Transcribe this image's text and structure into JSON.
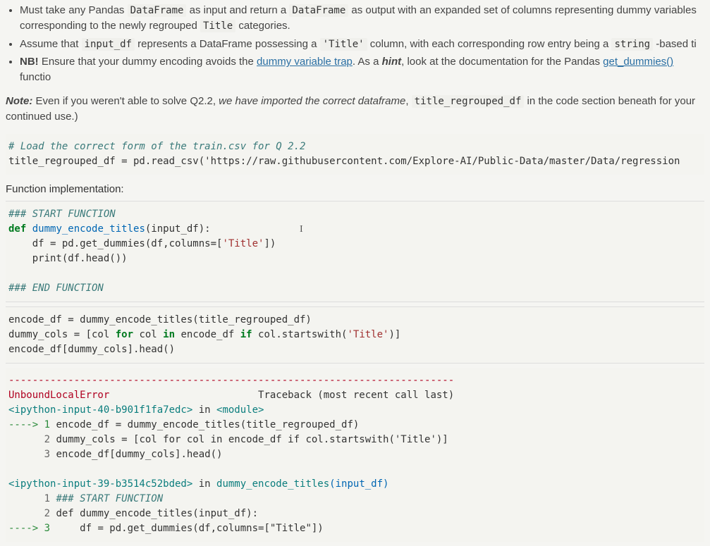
{
  "bullets": {
    "b1_pre": "Must take any Pandas ",
    "b1_code1": "DataFrame",
    "b1_mid1": " as input and return a ",
    "b1_code2": "DataFrame",
    "b1_mid2": " as output with an expanded set of columns representing dummy variables corresponding to the newly regrouped ",
    "b1_code3": "Title",
    "b1_post": " categories.",
    "b2_pre": "Assume that ",
    "b2_code1": "input_df",
    "b2_mid1": " represents a DataFrame possessing a ",
    "b2_code2": "'Title'",
    "b2_mid2": " column, with each corresponding row entry being a ",
    "b2_code3": "string",
    "b2_post": " -based ti",
    "b3_pre": "NB!",
    "b3_mid1": " Ensure that your dummy encoding avoids the ",
    "b3_link1": "dummy variable trap",
    "b3_mid2": ". As a ",
    "b3_hint": "hint",
    "b3_mid3": ", look at the documentation for the Pandas ",
    "b3_link2": "get_dummies()",
    "b3_post": " functio"
  },
  "note": {
    "label": "Note:",
    "t1": " Even if you weren't able to solve Q2.2, ",
    "t2": "we have imported the correct dataframe",
    "t3": ", ",
    "code": "title_regrouped_df",
    "t4": " in the code section beneath for your continued use.)"
  },
  "code1": {
    "comment": "# Load the correct form of the train.csv for Q 2.2",
    "line": "title_regrouped_df = pd.read_csv('https://raw.githubusercontent.com/Explore-AI/Public-Data/master/Data/regression"
  },
  "subhead": "Function implementation:",
  "code2": {
    "l1": "### START FUNCTION",
    "l2_def": "def",
    "l2_name": " dummy_encode_titles",
    "l2_rest": "(input_df):",
    "l3_a": "    df = pd.get_dummies(df,columns=[",
    "l3_str": "'Title'",
    "l3_b": "])",
    "l4_a": "    print(df.head())",
    "l6": "### END FUNCTION"
  },
  "code3": {
    "l1": "encode_df = dummy_encode_titles(title_regrouped_df)",
    "l2_a": "dummy_cols = [col ",
    "l2_for": "for",
    "l2_b": " col ",
    "l2_in": "in",
    "l2_c": " encode_df ",
    "l2_if": "if",
    "l2_d": " col.startswith(",
    "l2_str": "'Title'",
    "l2_e": ")]",
    "l3": "encode_df[dummy_cols].head()"
  },
  "trace": {
    "sep": "---------------------------------------------------------------------------",
    "err": "UnboundLocalError",
    "tb": "Traceback (most recent call last)",
    "mod1_a": "<ipython-input-40-b901f1fa7edc>",
    "mod1_b": " in ",
    "mod1_c": "<module>",
    "arrow": "----> 1",
    "l1": " encode_df = dummy_encode_titles(title_regrouped_df)",
    "n2": "      2",
    "l2": " dummy_cols = [col for col in encode_df if col.startswith('Title')]",
    "n3": "      3",
    "l3": " encode_df[dummy_cols].head()",
    "mod2_a": "<ipython-input-39-b3514c52bded>",
    "mod2_b": " in ",
    "mod2_c": "dummy_encode_titles",
    "mod2_d": "(input_df)",
    "s1n": "      1",
    "s1": " ### START FUNCTION",
    "s2n": "      2",
    "s2": " def dummy_encode_titles(input_df):",
    "s3arrow": "----> 3",
    "s3": "     df = pd.get_dummies(df,columns=[\"Title\"])"
  }
}
